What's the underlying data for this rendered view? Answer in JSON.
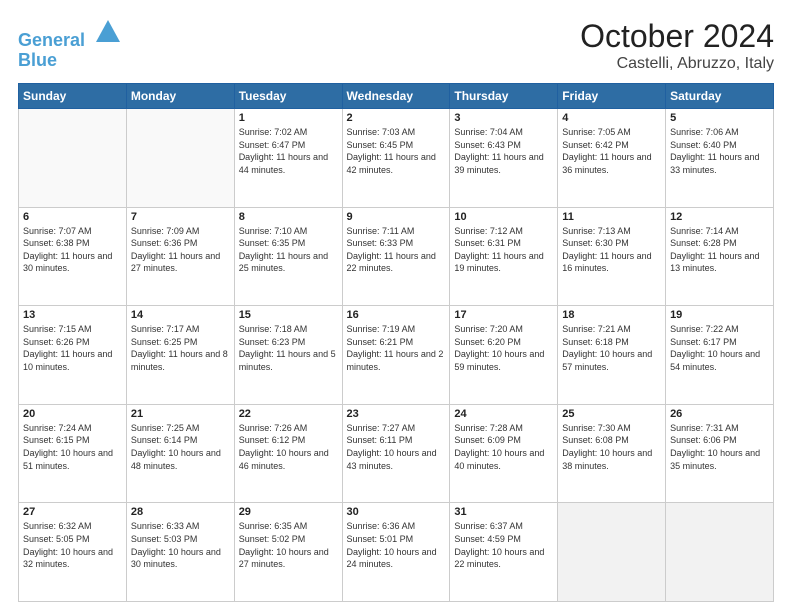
{
  "header": {
    "logo_line1": "General",
    "logo_line2": "Blue",
    "month": "October 2024",
    "location": "Castelli, Abruzzo, Italy"
  },
  "weekdays": [
    "Sunday",
    "Monday",
    "Tuesday",
    "Wednesday",
    "Thursday",
    "Friday",
    "Saturday"
  ],
  "weeks": [
    [
      {
        "day": "",
        "info": ""
      },
      {
        "day": "",
        "info": ""
      },
      {
        "day": "1",
        "info": "Sunrise: 7:02 AM\nSunset: 6:47 PM\nDaylight: 11 hours and 44 minutes."
      },
      {
        "day": "2",
        "info": "Sunrise: 7:03 AM\nSunset: 6:45 PM\nDaylight: 11 hours and 42 minutes."
      },
      {
        "day": "3",
        "info": "Sunrise: 7:04 AM\nSunset: 6:43 PM\nDaylight: 11 hours and 39 minutes."
      },
      {
        "day": "4",
        "info": "Sunrise: 7:05 AM\nSunset: 6:42 PM\nDaylight: 11 hours and 36 minutes."
      },
      {
        "day": "5",
        "info": "Sunrise: 7:06 AM\nSunset: 6:40 PM\nDaylight: 11 hours and 33 minutes."
      }
    ],
    [
      {
        "day": "6",
        "info": "Sunrise: 7:07 AM\nSunset: 6:38 PM\nDaylight: 11 hours and 30 minutes."
      },
      {
        "day": "7",
        "info": "Sunrise: 7:09 AM\nSunset: 6:36 PM\nDaylight: 11 hours and 27 minutes."
      },
      {
        "day": "8",
        "info": "Sunrise: 7:10 AM\nSunset: 6:35 PM\nDaylight: 11 hours and 25 minutes."
      },
      {
        "day": "9",
        "info": "Sunrise: 7:11 AM\nSunset: 6:33 PM\nDaylight: 11 hours and 22 minutes."
      },
      {
        "day": "10",
        "info": "Sunrise: 7:12 AM\nSunset: 6:31 PM\nDaylight: 11 hours and 19 minutes."
      },
      {
        "day": "11",
        "info": "Sunrise: 7:13 AM\nSunset: 6:30 PM\nDaylight: 11 hours and 16 minutes."
      },
      {
        "day": "12",
        "info": "Sunrise: 7:14 AM\nSunset: 6:28 PM\nDaylight: 11 hours and 13 minutes."
      }
    ],
    [
      {
        "day": "13",
        "info": "Sunrise: 7:15 AM\nSunset: 6:26 PM\nDaylight: 11 hours and 10 minutes."
      },
      {
        "day": "14",
        "info": "Sunrise: 7:17 AM\nSunset: 6:25 PM\nDaylight: 11 hours and 8 minutes."
      },
      {
        "day": "15",
        "info": "Sunrise: 7:18 AM\nSunset: 6:23 PM\nDaylight: 11 hours and 5 minutes."
      },
      {
        "day": "16",
        "info": "Sunrise: 7:19 AM\nSunset: 6:21 PM\nDaylight: 11 hours and 2 minutes."
      },
      {
        "day": "17",
        "info": "Sunrise: 7:20 AM\nSunset: 6:20 PM\nDaylight: 10 hours and 59 minutes."
      },
      {
        "day": "18",
        "info": "Sunrise: 7:21 AM\nSunset: 6:18 PM\nDaylight: 10 hours and 57 minutes."
      },
      {
        "day": "19",
        "info": "Sunrise: 7:22 AM\nSunset: 6:17 PM\nDaylight: 10 hours and 54 minutes."
      }
    ],
    [
      {
        "day": "20",
        "info": "Sunrise: 7:24 AM\nSunset: 6:15 PM\nDaylight: 10 hours and 51 minutes."
      },
      {
        "day": "21",
        "info": "Sunrise: 7:25 AM\nSunset: 6:14 PM\nDaylight: 10 hours and 48 minutes."
      },
      {
        "day": "22",
        "info": "Sunrise: 7:26 AM\nSunset: 6:12 PM\nDaylight: 10 hours and 46 minutes."
      },
      {
        "day": "23",
        "info": "Sunrise: 7:27 AM\nSunset: 6:11 PM\nDaylight: 10 hours and 43 minutes."
      },
      {
        "day": "24",
        "info": "Sunrise: 7:28 AM\nSunset: 6:09 PM\nDaylight: 10 hours and 40 minutes."
      },
      {
        "day": "25",
        "info": "Sunrise: 7:30 AM\nSunset: 6:08 PM\nDaylight: 10 hours and 38 minutes."
      },
      {
        "day": "26",
        "info": "Sunrise: 7:31 AM\nSunset: 6:06 PM\nDaylight: 10 hours and 35 minutes."
      }
    ],
    [
      {
        "day": "27",
        "info": "Sunrise: 6:32 AM\nSunset: 5:05 PM\nDaylight: 10 hours and 32 minutes."
      },
      {
        "day": "28",
        "info": "Sunrise: 6:33 AM\nSunset: 5:03 PM\nDaylight: 10 hours and 30 minutes."
      },
      {
        "day": "29",
        "info": "Sunrise: 6:35 AM\nSunset: 5:02 PM\nDaylight: 10 hours and 27 minutes."
      },
      {
        "day": "30",
        "info": "Sunrise: 6:36 AM\nSunset: 5:01 PM\nDaylight: 10 hours and 24 minutes."
      },
      {
        "day": "31",
        "info": "Sunrise: 6:37 AM\nSunset: 4:59 PM\nDaylight: 10 hours and 22 minutes."
      },
      {
        "day": "",
        "info": ""
      },
      {
        "day": "",
        "info": ""
      }
    ]
  ]
}
